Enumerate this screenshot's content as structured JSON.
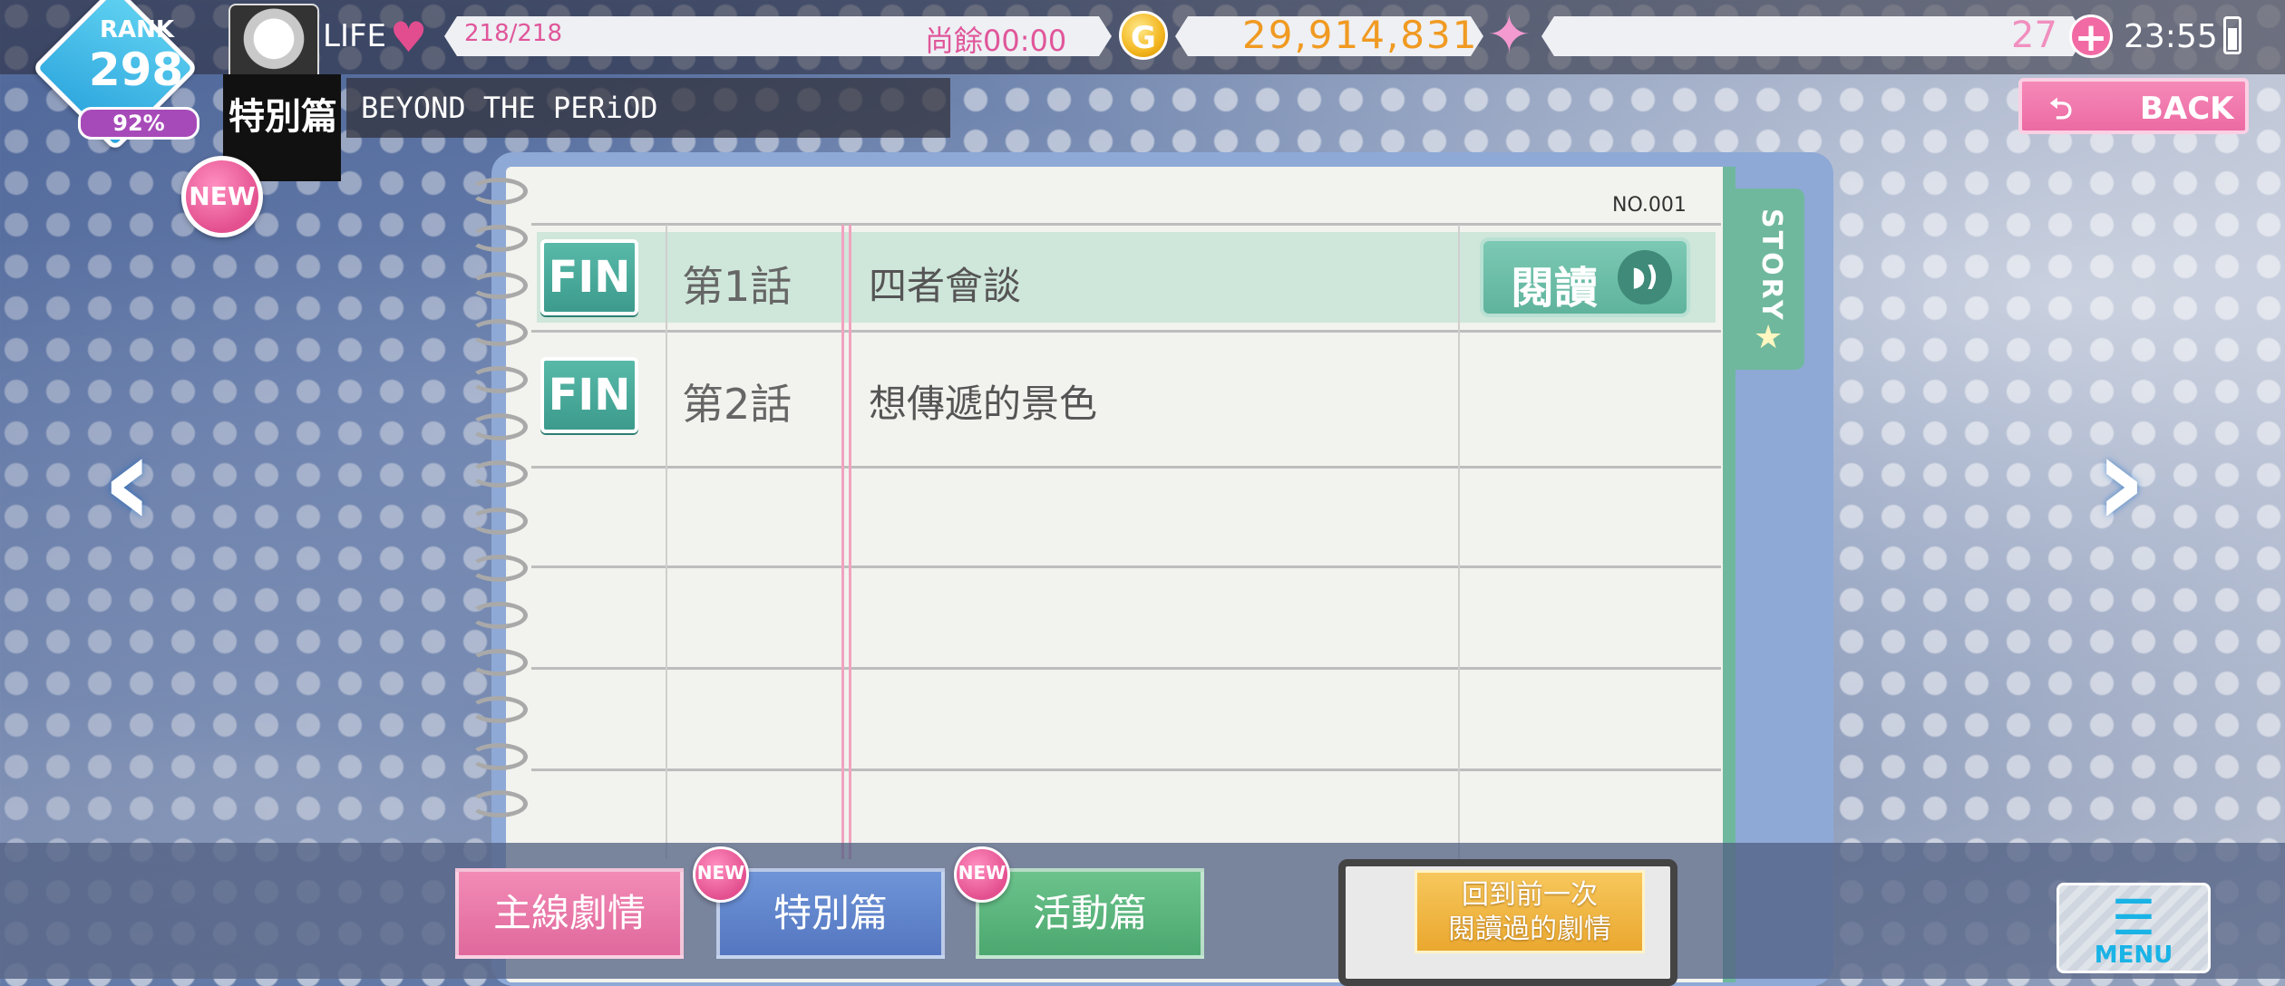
{
  "header": {
    "rank_label": "RANK",
    "rank_value": "298",
    "rank_percent": "92%",
    "life_label": "LIFE",
    "life_value": "218/218",
    "life_timer": "尚餘00:00",
    "gold_icon_letter": "G",
    "gold_value": "29,914,831",
    "gem_value": "27",
    "time": "23:55"
  },
  "title": {
    "category": "特別篇",
    "name": "BEYOND THE PERiOD"
  },
  "badges": {
    "new": "NEW"
  },
  "back_button": {
    "label": "BACK"
  },
  "notebook": {
    "page_no": "NO.001",
    "tab_label": "STORY",
    "episodes": [
      {
        "status": "FIN",
        "number": "第1話",
        "title": "四者會談",
        "action": "閱讀"
      },
      {
        "status": "FIN",
        "number": "第2話",
        "title": "想傳遞的景色"
      }
    ]
  },
  "bottom": {
    "tabs": [
      "主線劇情",
      "特別篇",
      "活動篇"
    ],
    "return_line1": "回到前一次",
    "return_line2": "閱讀過的劇情",
    "menu_label": "MENU"
  },
  "icons": {
    "heart": "heart-icon",
    "coin": "gold-coin-icon",
    "star": "star-gem-icon",
    "plus": "plus-icon",
    "battery": "battery-icon",
    "back": "back-arrow-icon",
    "prev": "chevron-left-icon",
    "next": "chevron-right-icon",
    "audio": "audio-icon",
    "menu": "menu-icon"
  },
  "colors": {
    "accent_pink": "#ec6aa3",
    "accent_green": "#5fb39c",
    "accent_blue": "#5476c0",
    "gold": "#f09a22"
  }
}
